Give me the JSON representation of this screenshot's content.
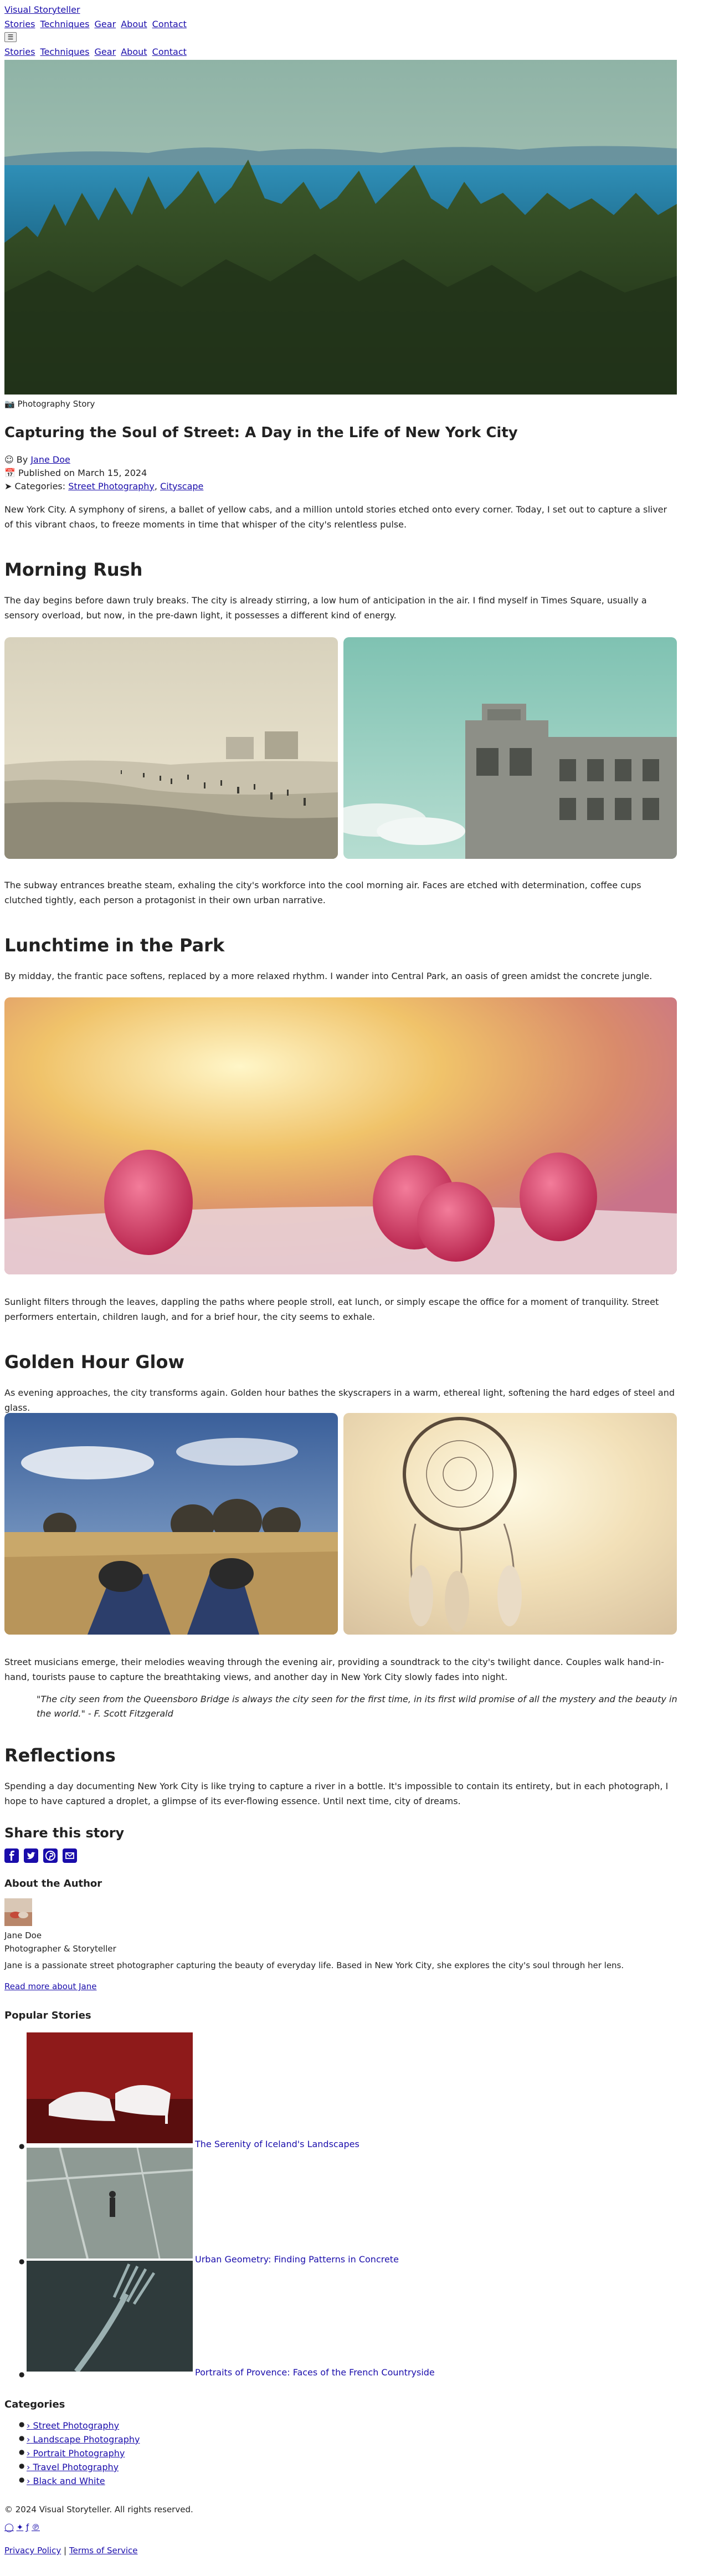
{
  "site": {
    "title": "Visual Storyteller"
  },
  "nav": {
    "items": [
      "Stories",
      "Techniques",
      "Gear",
      "About",
      "Contact"
    ],
    "menu_icon": "menu-icon"
  },
  "article": {
    "category_icon": "camera-icon",
    "category": "Photography Story",
    "title": "Capturing the Soul of Street: A Day in the Life of New York City",
    "by_label": "By",
    "author": "Jane Doe",
    "published_label": "Published on",
    "published_date": "March 15, 2024",
    "categories_label": "Categories:",
    "tags": [
      "Street Photography",
      "Cityscape"
    ],
    "tag_separator": ",",
    "intro": "New York City. A symphony of sirens, a ballet of yellow cabs, and a million untold stories etched onto every corner. Today, I set out to capture a sliver of this vibrant chaos, to freeze moments in time that whisper of the city's relentless pulse.",
    "sections": [
      {
        "heading": "Morning Rush",
        "p1": "The day begins before dawn truly breaks. The city is already stirring, a low hum of anticipation in the air. I find myself in Times Square, usually a sensory overload, but now, in the pre-dawn light, it possesses a different kind of energy.",
        "p2": "The subway entrances breathe steam, exhaling the city's workforce into the cool morning air. Faces are etched with determination, coffee cups clutched tightly, each person a protagonist in their own urban narrative."
      },
      {
        "heading": "Lunchtime in the Park",
        "p1": "By midday, the frantic pace softens, replaced by a more relaxed rhythm. I wander into Central Park, an oasis of green amidst the concrete jungle.",
        "p2": "Sunlight filters through the leaves, dappling the paths where people stroll, eat lunch, or simply escape the office for a moment of tranquility. Street performers entertain, children laugh, and for a brief hour, the city seems to exhale."
      },
      {
        "heading": "Golden Hour Glow",
        "p1": "As evening approaches, the city transforms again. Golden hour bathes the skyscrapers in a warm, ethereal light, softening the hard edges of steel and glass.",
        "p2": "Street musicians emerge, their melodies weaving through the evening air, providing a soundtrack to the city's twilight dance. Couples walk hand-in-hand, tourists pause to capture the breathtaking views, and another day in New York City slowly fades into night.",
        "quote": "\"The city seen from the Queensboro Bridge is always the city seen for the first time, in its first wild promise of all the mystery and the beauty in the world.\" - F. Scott Fitzgerald"
      },
      {
        "heading": "Reflections",
        "p1": "Spending a day documenting New York City is like trying to capture a river in a bottle. It's impossible to contain its entirety, but in each photograph, I hope to have captured a droplet, a glimpse of its ever-flowing essence. Until next time, city of dreams."
      }
    ]
  },
  "share": {
    "heading": "Share this story",
    "icons": [
      "facebook-icon",
      "twitter-icon",
      "pinterest-icon",
      "email-icon"
    ],
    "color": "#1a0dab"
  },
  "author_box": {
    "heading": "About the Author",
    "name": "Jane Doe",
    "role": "Photographer & Storyteller",
    "bio": "Jane is a passionate street photographer capturing the beauty of everyday life. Based in New York City, she explores the city's soul through her lens.",
    "link": "Read more about Jane"
  },
  "popular": {
    "heading": "Popular Stories",
    "items": [
      {
        "title": "The Serenity of Iceland's Landscapes"
      },
      {
        "title": "Urban Geometry: Finding Patterns in Concrete"
      },
      {
        "title": "Portraits of Provence: Faces of the French Countryside"
      }
    ]
  },
  "categories": {
    "heading": "Categories",
    "items": [
      "Street Photography",
      "Landscape Photography",
      "Portrait Photography",
      "Travel Photography",
      "Black and White"
    ]
  },
  "footer": {
    "copyright": "© 2024 Visual Storyteller. All rights reserved.",
    "social_icons": [
      "instagram-icon",
      "twitter-icon",
      "facebook-icon",
      "pinterest-icon"
    ],
    "privacy": "Privacy Policy",
    "separator": "|",
    "terms": "Terms of Service"
  }
}
